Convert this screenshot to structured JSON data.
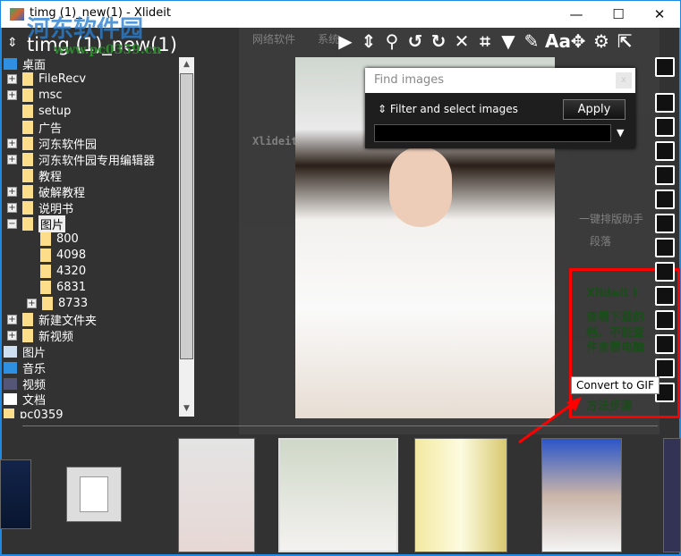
{
  "window": {
    "title": "timg (1)_new(1) - Xlideit",
    "minimize": "—",
    "maximize": "☐",
    "close": "✕"
  },
  "watermark": {
    "name": "河东软件园",
    "url": "www.pc0359.cn"
  },
  "path_title": "timg (1)_new(1)",
  "toolbar": [
    {
      "icon": "play-icon",
      "glyph": "▶"
    },
    {
      "icon": "sort-icon",
      "glyph": "⇕"
    },
    {
      "icon": "search-icon",
      "glyph": "⚲"
    },
    {
      "icon": "rotate-left-icon",
      "glyph": "↺"
    },
    {
      "icon": "rotate-right-icon",
      "glyph": "↻"
    },
    {
      "icon": "close-icon",
      "glyph": "✕"
    },
    {
      "icon": "crop-icon",
      "glyph": "⌗"
    },
    {
      "icon": "dropdown-icon",
      "glyph": "▼"
    },
    {
      "icon": "edit-icon",
      "glyph": "✎"
    },
    {
      "icon": "text-size-icon",
      "glyph": "Aa"
    },
    {
      "icon": "pan-icon",
      "glyph": "✥"
    },
    {
      "icon": "settings-icon",
      "glyph": "⚙"
    },
    {
      "icon": "fullscreen-icon",
      "glyph": "⇱"
    }
  ],
  "tree": [
    {
      "label": "桌面",
      "level": 0,
      "toggle": "",
      "type": "desktop"
    },
    {
      "label": "FileRecv",
      "level": 1,
      "toggle": "+"
    },
    {
      "label": "msc",
      "level": 1,
      "toggle": "+"
    },
    {
      "label": "setup",
      "level": 1,
      "toggle": ""
    },
    {
      "label": "广告",
      "level": 1,
      "toggle": ""
    },
    {
      "label": "河东软件园",
      "level": 1,
      "toggle": "+"
    },
    {
      "label": "河东软件园专用编辑器",
      "level": 1,
      "toggle": "+"
    },
    {
      "label": "教程",
      "level": 1,
      "toggle": ""
    },
    {
      "label": "破解教程",
      "level": 1,
      "toggle": "+"
    },
    {
      "label": "说明书",
      "level": 1,
      "toggle": "+"
    },
    {
      "label": "图片",
      "level": 1,
      "toggle": "−",
      "selected": true
    },
    {
      "label": "800",
      "level": 2,
      "toggle": ""
    },
    {
      "label": "4098",
      "level": 2,
      "toggle": ""
    },
    {
      "label": "4320",
      "level": 2,
      "toggle": ""
    },
    {
      "label": "6831",
      "level": 2,
      "toggle": ""
    },
    {
      "label": "8733",
      "level": 2,
      "toggle": "+"
    },
    {
      "label": "新建文件夹",
      "level": 1,
      "toggle": "+"
    },
    {
      "label": "新视频",
      "level": 1,
      "toggle": "+"
    },
    {
      "label": "图片",
      "level": 0,
      "toggle": "",
      "type": "pictures"
    },
    {
      "label": "音乐",
      "level": 0,
      "toggle": "",
      "type": "music"
    },
    {
      "label": "视频",
      "level": 0,
      "toggle": "",
      "type": "video"
    },
    {
      "label": "文档",
      "level": 0,
      "toggle": "",
      "type": "documents"
    },
    {
      "label": "pc0359",
      "level": 0,
      "toggle": ""
    }
  ],
  "find_dialog": {
    "title": "Find images",
    "close": "x",
    "filter_label": "Filter and select images",
    "apply": "Apply",
    "input_value": ""
  },
  "right_toolbar": [
    "collapse-up-icon",
    "copy-to-icon",
    "move-to-icon",
    "capture-icon",
    "gallery-icon",
    "rotate-icon",
    "flip-horizontal-icon",
    "flip-vertical-icon",
    "image-icon",
    "resize-icon",
    "convert-icon",
    "export-icon",
    "convert-gif-icon",
    "grid-icon"
  ],
  "tooltip": "Convert to GIF",
  "background_page": {
    "nav1": "网络软件",
    "nav2": "系统",
    "heading": "Xlideit I",
    "red_lines": [
      "Xlideit I",
      "查看下载的",
      "档，不能查",
      "件查看电脑",
      "方法步骤"
    ],
    "helper": "一键排版助手",
    "para": "段落"
  },
  "colors": {
    "accent": "#1e88e5",
    "highlight": "#ff0000",
    "background": "#323232"
  }
}
